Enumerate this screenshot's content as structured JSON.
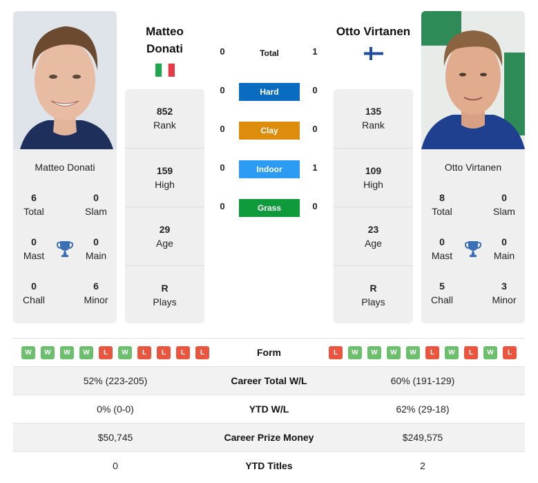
{
  "player1": {
    "name": "Matteo Donati",
    "name_line1": "Matteo",
    "name_line2": "Donati",
    "flag": "italy-flag",
    "photo": "player-photo",
    "titles": {
      "total": {
        "value": "6",
        "label": "Total"
      },
      "slam": {
        "value": "0",
        "label": "Slam"
      },
      "mast": {
        "value": "0",
        "label": "Mast"
      },
      "main": {
        "value": "0",
        "label": "Main"
      },
      "chall": {
        "value": "0",
        "label": "Chall"
      },
      "minor": {
        "value": "6",
        "label": "Minor"
      }
    },
    "stats": {
      "rank": {
        "value": "852",
        "label": "Rank"
      },
      "high": {
        "value": "159",
        "label": "High"
      },
      "age": {
        "value": "29",
        "label": "Age"
      },
      "plays": {
        "value": "R",
        "label": "Plays"
      }
    },
    "form": [
      "W",
      "W",
      "W",
      "W",
      "L",
      "W",
      "L",
      "L",
      "L",
      "L"
    ]
  },
  "player2": {
    "name": "Otto Virtanen",
    "flag": "finland-flag",
    "photo": "player-photo",
    "titles": {
      "total": {
        "value": "8",
        "label": "Total"
      },
      "slam": {
        "value": "0",
        "label": "Slam"
      },
      "mast": {
        "value": "0",
        "label": "Mast"
      },
      "main": {
        "value": "0",
        "label": "Main"
      },
      "chall": {
        "value": "5",
        "label": "Chall"
      },
      "minor": {
        "value": "3",
        "label": "Minor"
      }
    },
    "stats": {
      "rank": {
        "value": "135",
        "label": "Rank"
      },
      "high": {
        "value": "109",
        "label": "High"
      },
      "age": {
        "value": "23",
        "label": "Age"
      },
      "plays": {
        "value": "R",
        "label": "Plays"
      }
    },
    "form": [
      "L",
      "W",
      "W",
      "W",
      "W",
      "L",
      "W",
      "L",
      "W",
      "L"
    ]
  },
  "h2h": {
    "total": {
      "label": "Total",
      "p1": "0",
      "p2": "1"
    },
    "surfaces": [
      {
        "label": "Hard",
        "p1": "0",
        "p2": "0",
        "color": "#0a6cc1"
      },
      {
        "label": "Clay",
        "p1": "0",
        "p2": "0",
        "color": "#dd8d0b"
      },
      {
        "label": "Indoor",
        "p1": "0",
        "p2": "1",
        "color": "#2b9bf4"
      },
      {
        "label": "Grass",
        "p1": "0",
        "p2": "0",
        "color": "#0f9a3b"
      }
    ]
  },
  "comparison": {
    "form_label": "Form",
    "rows": [
      {
        "label": "Career Total W/L",
        "p1": "52% (223-205)",
        "p2": "60% (191-129)"
      },
      {
        "label": "YTD W/L",
        "p1": "0% (0-0)",
        "p2": "62% (29-18)"
      },
      {
        "label": "Career Prize Money",
        "p1": "$50,745",
        "p2": "$249,575"
      },
      {
        "label": "YTD Titles",
        "p1": "0",
        "p2": "2"
      }
    ]
  },
  "colors": {
    "win": "#6cbf6c",
    "loss": "#e9553f",
    "card_bg": "#efefef",
    "trophy": "#3b6fb6"
  }
}
